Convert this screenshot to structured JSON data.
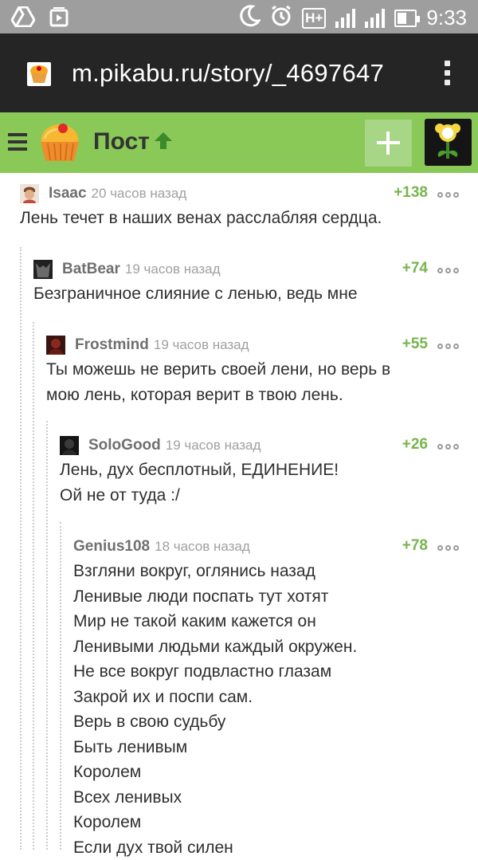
{
  "status_bar": {
    "time": "9:33",
    "battery_level": 0.55
  },
  "browser": {
    "url": "m.pikabu.ru/story/_4697647"
  },
  "header": {
    "title": "Пост"
  },
  "colors": {
    "header_bg": "#8ac858",
    "rating": "#76b64c",
    "url_bar_bg": "#252525"
  },
  "comments": [
    {
      "user": "Isaac",
      "time": "20 часов назад",
      "rating": "+138",
      "text": "Лень течет в наших венах расслабляя сердца."
    },
    {
      "user": "BatBear",
      "time": "19 часов назад",
      "rating": "+74",
      "text": "Безграничное слияние с ленью, ведь мне"
    },
    {
      "user": "Frostmind",
      "time": "19 часов назад",
      "rating": "+55",
      "text": "Ты можешь не верить своей лени, но верь в\nмою лень, которая верит в твою лень."
    },
    {
      "user": "SoloGood",
      "time": "19 часов назад",
      "rating": "+26",
      "text": "Лень, дух бесплотный, ЕДИНЕНИЕ!\nОй не от туда :/"
    },
    {
      "user": "Genius108",
      "time": "18 часов назад",
      "rating": "+78",
      "text": "Взгляни вокруг, оглянись назад\nЛенивые люди поспать тут хотят\nМир не такой каким кажется он\nЛенивыми людьми каждый окружен.\nНе все вокруг подвластно глазам\nЗакрой их и поспи сам.\nВерь в свою судьбу\nБыть ленивым\nКоролем\nВсех ленивых\nКоролем\nЕсли дух твой силен"
    }
  ]
}
